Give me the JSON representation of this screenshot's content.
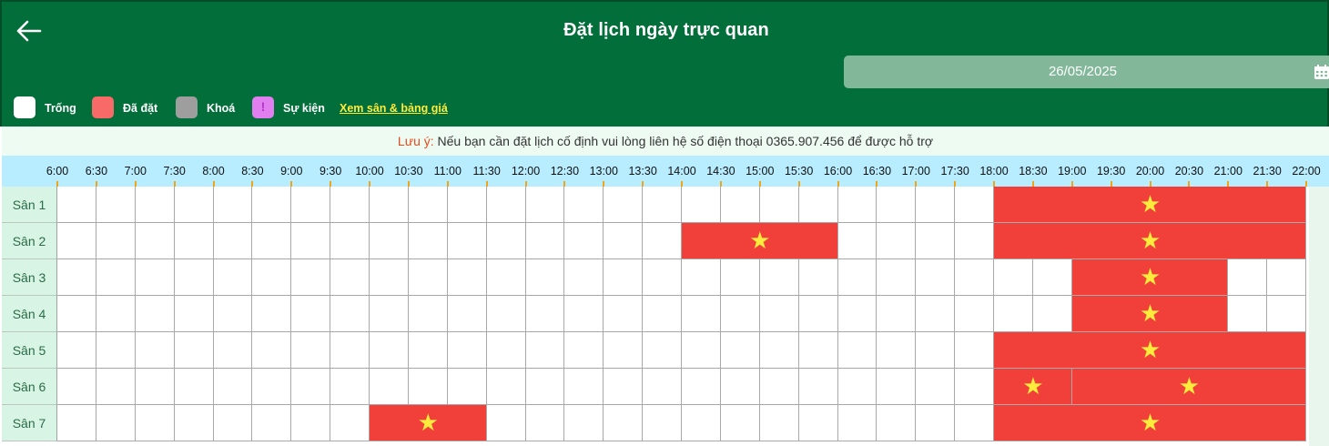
{
  "header": {
    "title": "Đặt lịch ngày trực quan",
    "back_icon": "arrow-left-icon",
    "date": "26/05/2025",
    "calendar_icon": "calendar-icon"
  },
  "colors": {
    "header_bg": "#026e3a",
    "free": "#ffffff",
    "booked": "#f1403a",
    "locked": "#9e9e9e",
    "event": "#e27ff0",
    "star": "#ffeb3b",
    "time_bar": "#b8ecff"
  },
  "legend": [
    {
      "label": "Trống",
      "type": "free"
    },
    {
      "label": "Đã đặt",
      "type": "booked"
    },
    {
      "label": "Khoá",
      "type": "locked"
    },
    {
      "label": "Sự kiện",
      "type": "event",
      "symbol": "!"
    }
  ],
  "price_link": "Xem sân & bảng giá",
  "notice": {
    "label": "Lưu ý:",
    "text": "Nếu bạn cần đặt lịch cố định vui lòng liên hệ số điện thoại 0365.907.456 để được hỗ trợ"
  },
  "times": [
    "6:00",
    "6:30",
    "7:00",
    "7:30",
    "8:00",
    "8:30",
    "9:00",
    "9:30",
    "10:00",
    "10:30",
    "11:00",
    "11:30",
    "12:00",
    "12:30",
    "13:00",
    "13:30",
    "14:00",
    "14:30",
    "15:00",
    "15:30",
    "16:00",
    "16:30",
    "17:00",
    "17:30",
    "18:00",
    "18:30",
    "19:00",
    "19:30",
    "20:00",
    "20:30",
    "21:00",
    "21:30",
    "22:00"
  ],
  "courts": [
    {
      "name": "Sân 1",
      "bookings": [
        {
          "start": "18:00",
          "end": "22:00"
        }
      ]
    },
    {
      "name": "Sân 2",
      "bookings": [
        {
          "start": "14:00",
          "end": "16:00"
        },
        {
          "start": "18:00",
          "end": "22:00"
        }
      ]
    },
    {
      "name": "Sân 3",
      "bookings": [
        {
          "start": "19:00",
          "end": "21:00"
        }
      ]
    },
    {
      "name": "Sân 4",
      "bookings": [
        {
          "start": "19:00",
          "end": "21:00"
        }
      ]
    },
    {
      "name": "Sân 5",
      "bookings": [
        {
          "start": "18:00",
          "end": "22:00"
        }
      ]
    },
    {
      "name": "Sân 6",
      "bookings": [
        {
          "start": "18:00",
          "end": "19:00"
        },
        {
          "start": "19:00",
          "end": "22:00"
        }
      ]
    },
    {
      "name": "Sân 7",
      "bookings": [
        {
          "start": "10:00",
          "end": "11:30"
        },
        {
          "start": "18:00",
          "end": "22:00"
        }
      ]
    }
  ]
}
